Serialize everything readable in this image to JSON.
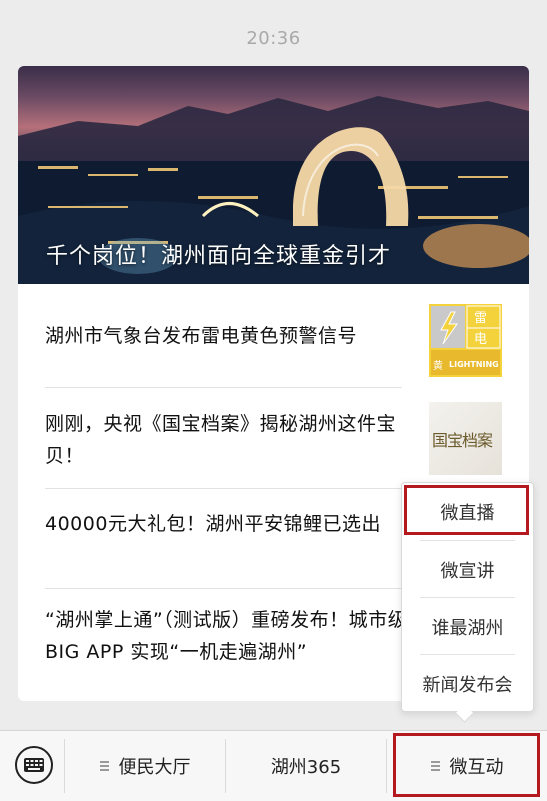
{
  "status": {
    "time": "20:36"
  },
  "hero": {
    "title": "千个岗位！湖州面向全球重金引才",
    "image_icon": "city-night-photo"
  },
  "articles": [
    {
      "title": "湖州市气象台发布雷电黄色预警信号",
      "thumb_icon": "lightning-warning-icon",
      "thumb_label_top": "雷",
      "thumb_label_mid": "电",
      "thumb_label_bottom": "黄",
      "thumb_label_en": "LIGHTNING"
    },
    {
      "title": "刚刚，央视《国宝档案》揭秘湖州这件宝贝！",
      "thumb_icon": "calligraphy-thumbnail",
      "thumb_label": "国宝档案"
    },
    {
      "title": "40000元大礼包！湖州平安锦鲤已选出"
    },
    {
      "title": "“湖州掌上通”（测试版）重磅发布！城市级BIG APP 实现“一机走遍湖州”"
    }
  ],
  "popup_menu": [
    "微直播",
    "微宣讲",
    "谁最湖州",
    "新闻发布会"
  ],
  "tabbar": {
    "keyboard_icon": "keyboard-icon",
    "tabs": [
      "便民大厅",
      "湖州365",
      "微互动"
    ]
  },
  "colors": {
    "highlight": "#b3191f",
    "background": "#ececec",
    "lightning_thumb": "#f4d23c"
  }
}
